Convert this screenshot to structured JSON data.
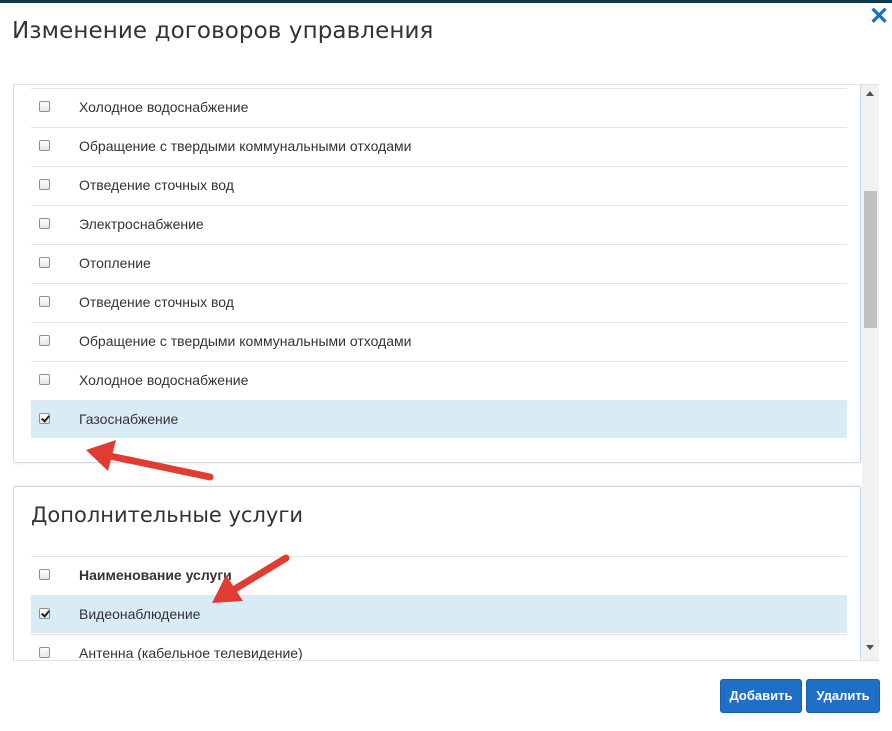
{
  "modal": {
    "title": "Изменение договоров управления",
    "close_icon": "close-icon"
  },
  "utilities_list": {
    "items": [
      {
        "label": "Холодное водоснабжение",
        "checked": false
      },
      {
        "label": "Обращение с твердыми коммунальными отходами",
        "checked": false
      },
      {
        "label": "Отведение сточных вод",
        "checked": false
      },
      {
        "label": "Электроснабжение",
        "checked": false
      },
      {
        "label": "Отопление",
        "checked": false
      },
      {
        "label": "Отведение сточных вод",
        "checked": false
      },
      {
        "label": "Обращение с твердыми коммунальными отходами",
        "checked": false
      },
      {
        "label": "Холодное водоснабжение",
        "checked": false
      },
      {
        "label": "Газоснабжение",
        "checked": true
      }
    ]
  },
  "additional_services": {
    "heading": "Дополнительные услуги",
    "header_label": "Наименование услуги",
    "header_checked": false,
    "items": [
      {
        "label": "Видеонаблюдение",
        "checked": true
      },
      {
        "label": "Антенна (кабельное телевидение)",
        "checked": false
      }
    ]
  },
  "footer": {
    "add_label": "Добавить",
    "delete_label": "Удалить"
  },
  "colors": {
    "accent": "#1f6fc7",
    "selected_row": "#d9ebf5",
    "annotation_arrow": "#e03c31"
  }
}
